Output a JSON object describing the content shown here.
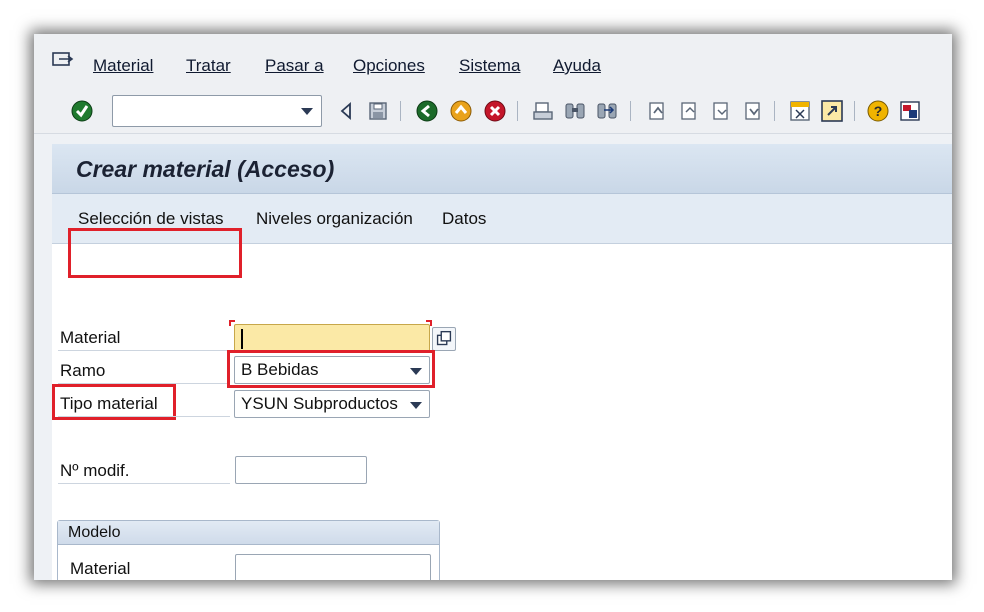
{
  "menu": {
    "items": [
      {
        "label": "Material"
      },
      {
        "label": "Tratar"
      },
      {
        "label": "Pasar a"
      },
      {
        "label": "Opciones"
      },
      {
        "label": "Sistema"
      },
      {
        "label": "Ayuda"
      }
    ]
  },
  "toolbar": {
    "command_field_value": "",
    "icons": [
      "enter-icon",
      "back-icon",
      "save-icon",
      "back-green-icon",
      "exit-icon",
      "cancel-icon",
      "print-icon",
      "find-icon",
      "find-next-icon",
      "first-page-icon",
      "prev-page-icon",
      "next-page-icon",
      "last-page-icon",
      "new-session-icon",
      "shortcut-icon",
      "help-icon",
      "layout-icon"
    ]
  },
  "page": {
    "title": "Crear material (Acceso)"
  },
  "app_toolbar": {
    "buttons": [
      "Selección de vistas",
      "Niveles organización",
      "Datos"
    ]
  },
  "form": {
    "material_label": "Material",
    "material_value": "",
    "ramo_label": "Ramo",
    "ramo_value": "B Bebidas",
    "tipo_label": "Tipo material",
    "tipo_value": "YSUN Subproductos",
    "modif_label": "Nº modif.",
    "modif_value": ""
  },
  "modelo": {
    "title": "Modelo",
    "material_label": "Material",
    "material_value": ""
  },
  "colors": {
    "highlight": "#e0202a",
    "active_field": "#fbe9a6",
    "title_bar": "#c9d7e7"
  }
}
